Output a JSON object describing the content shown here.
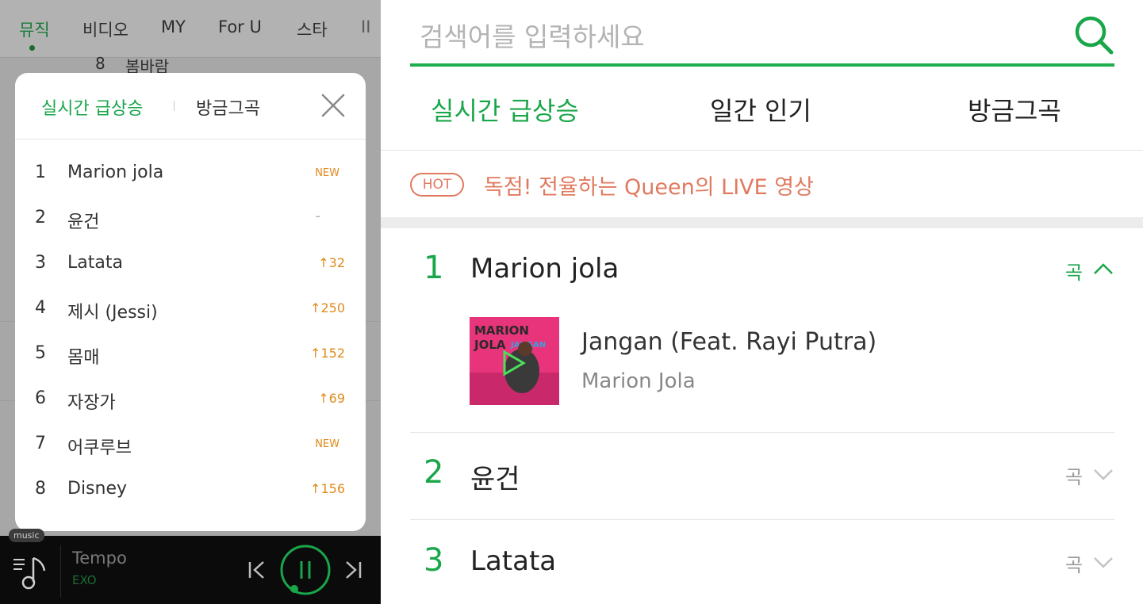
{
  "left_nav": {
    "tabs": [
      "뮤직",
      "비디오",
      "MY",
      "For U",
      "스타",
      "II"
    ],
    "active": "뮤직"
  },
  "background_list": {
    "rows": [
      {
        "rank": "8",
        "title": "봄바람"
      }
    ]
  },
  "popup": {
    "tabs": [
      "실시간 급상승",
      "방금그곡"
    ],
    "active_tab": "실시간 급상승",
    "close_icon": "close-icon",
    "items": [
      {
        "rank": "1",
        "title": "Marion jola",
        "change": "NEW"
      },
      {
        "rank": "2",
        "title": "윤건",
        "change": "-"
      },
      {
        "rank": "3",
        "title": "Latata",
        "change": "↑32"
      },
      {
        "rank": "4",
        "title": "제시 (Jessi)",
        "change": "↑250"
      },
      {
        "rank": "5",
        "title": "몸매",
        "change": "↑152"
      },
      {
        "rank": "6",
        "title": "자장가",
        "change": "↑69"
      },
      {
        "rank": "7",
        "title": "어쿠루브",
        "change": "NEW"
      },
      {
        "rank": "8",
        "title": "Disney",
        "change": "↑156"
      }
    ]
  },
  "player": {
    "badge": "music",
    "song": "Tempo",
    "artist": "EXO",
    "accent": "#1d6b33"
  },
  "search": {
    "placeholder": "검색어를 입력하세요",
    "icon": "search-icon",
    "accent": "#1fae4b"
  },
  "chart_tabs": {
    "tabs": [
      "실시간 급상승",
      "일간 인기",
      "방금그곡"
    ],
    "active": "실시간 급상승"
  },
  "hot_banner": {
    "badge": "HOT",
    "text": "독점! 전율하는 Queen의 LIVE 영상",
    "color": "#e07a5f"
  },
  "ranking": [
    {
      "rank": "1",
      "name": "Marion jola",
      "type": "곡",
      "expanded": true,
      "track": {
        "title": "Jangan (Feat. Rayi Putra)",
        "artist": "Marion Jola",
        "album_text": [
          "MARION",
          "JOLA",
          "JANGAN"
        ]
      }
    },
    {
      "rank": "2",
      "name": "윤건",
      "type": "곡",
      "expanded": false
    },
    {
      "rank": "3",
      "name": "Latata",
      "type": "곡",
      "expanded": false
    }
  ]
}
